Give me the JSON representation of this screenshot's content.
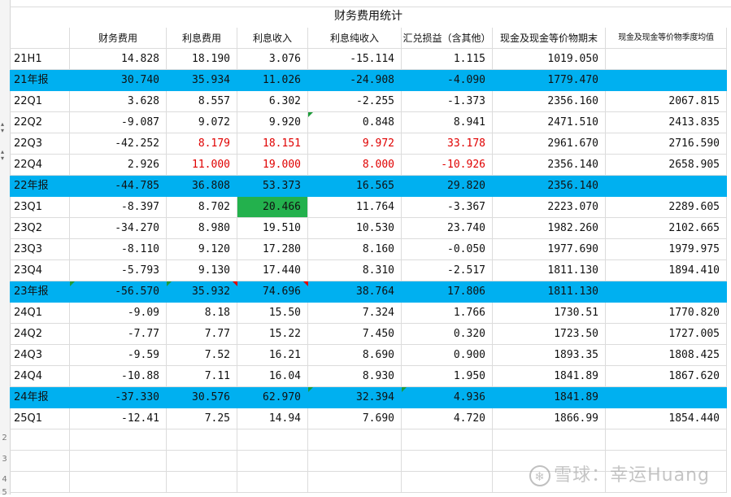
{
  "title": "财务费用统计",
  "headers": [
    "",
    "财务费用",
    "利息费用",
    "利息收入",
    "利息纯收入",
    "汇兑损益（含其他）",
    "现金及现金等价物期末",
    "现金及现金等价物季度均值"
  ],
  "rows": [
    {
      "label": "21H1",
      "hl": false,
      "cells": [
        "14.828",
        "18.190",
        "3.076",
        "-15.114",
        "1.115",
        "1019.050",
        ""
      ]
    },
    {
      "label": "21年报",
      "hl": true,
      "cells": [
        "30.740",
        "35.934",
        "11.026",
        "-24.908",
        "-4.090",
        "1779.470",
        ""
      ]
    },
    {
      "label": "22Q1",
      "hl": false,
      "cells": [
        "3.628",
        "8.557",
        "6.302",
        "-2.255",
        "-1.373",
        "2356.160",
        "2067.815"
      ]
    },
    {
      "label": "22Q2",
      "hl": false,
      "cells": [
        "-9.087",
        "9.072",
        "9.920",
        "0.848",
        "8.941",
        "2471.510",
        "2413.835"
      ]
    },
    {
      "label": "22Q3",
      "hl": false,
      "cells": [
        "-42.252",
        "8.179",
        "18.151",
        "9.972",
        "33.178",
        "2961.670",
        "2716.590"
      ]
    },
    {
      "label": "22Q4",
      "hl": false,
      "cells": [
        "2.926",
        "11.000",
        "19.000",
        "8.000",
        "-10.926",
        "2356.140",
        "2658.905"
      ]
    },
    {
      "label": "22年报",
      "hl": true,
      "cells": [
        "-44.785",
        "36.808",
        "53.373",
        "16.565",
        "29.820",
        "2356.140",
        ""
      ]
    },
    {
      "label": "23Q1",
      "hl": false,
      "cells": [
        "-8.397",
        "8.702",
        "20.466",
        "11.764",
        "-3.367",
        "2223.070",
        "2289.605"
      ]
    },
    {
      "label": "23Q2",
      "hl": false,
      "cells": [
        "-34.270",
        "8.980",
        "19.510",
        "10.530",
        "23.740",
        "1982.260",
        "2102.665"
      ]
    },
    {
      "label": "23Q3",
      "hl": false,
      "cells": [
        "-8.110",
        "9.120",
        "17.280",
        "8.160",
        "-0.050",
        "1977.690",
        "1979.975"
      ]
    },
    {
      "label": "23Q4",
      "hl": false,
      "cells": [
        "-5.793",
        "9.130",
        "17.440",
        "8.310",
        "-2.517",
        "1811.130",
        "1894.410"
      ]
    },
    {
      "label": "23年报",
      "hl": true,
      "cells": [
        "-56.570",
        "35.932",
        "74.696",
        "38.764",
        "17.806",
        "1811.130",
        ""
      ]
    },
    {
      "label": "24Q1",
      "hl": false,
      "cells": [
        "-9.09",
        "8.18",
        "15.50",
        "7.324",
        "1.766",
        "1730.51",
        "1770.820"
      ]
    },
    {
      "label": "24Q2",
      "hl": false,
      "cells": [
        "-7.77",
        "7.77",
        "15.22",
        "7.450",
        "0.320",
        "1723.50",
        "1727.005"
      ]
    },
    {
      "label": "24Q3",
      "hl": false,
      "cells": [
        "-9.59",
        "7.52",
        "16.21",
        "8.690",
        "0.900",
        "1893.35",
        "1808.425"
      ]
    },
    {
      "label": "24Q4",
      "hl": false,
      "cells": [
        "-10.88",
        "7.11",
        "16.04",
        "8.930",
        "1.950",
        "1841.89",
        "1867.620"
      ]
    },
    {
      "label": "24年报",
      "hl": true,
      "cells": [
        "-37.330",
        "30.576",
        "62.970",
        "32.394",
        "4.936",
        "1841.89",
        ""
      ]
    },
    {
      "label": "25Q1",
      "hl": false,
      "cells": [
        "-12.41",
        "7.25",
        "14.94",
        "7.690",
        "4.720",
        "1866.99",
        "1854.440"
      ]
    }
  ],
  "highlight_color": "#00b0f0",
  "red_text_color": "#e00000",
  "green_fill_color": "#23b14d",
  "gutter_numbers": [
    "2",
    "3",
    "4",
    "5"
  ],
  "watermark": {
    "icon": "snowball-icon",
    "text": "雪球：幸运Huang"
  }
}
